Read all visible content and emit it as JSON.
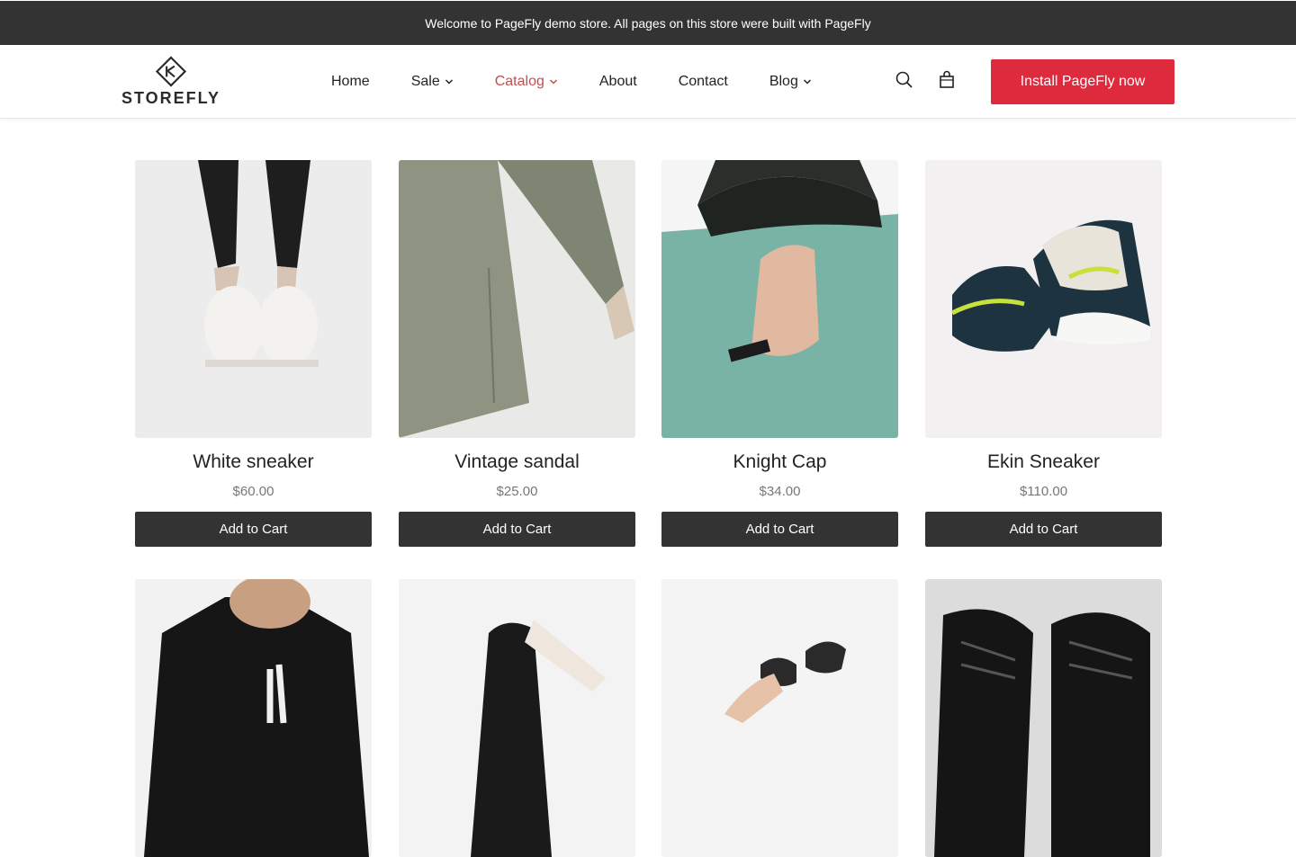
{
  "announcement": "Welcome to PageFly demo store. All pages on this store were built with PageFly",
  "logo": {
    "text": "STOREFLY"
  },
  "nav": [
    {
      "label": "Home",
      "dropdown": false,
      "active": false
    },
    {
      "label": "Sale",
      "dropdown": true,
      "active": false
    },
    {
      "label": "Catalog",
      "dropdown": true,
      "active": true
    },
    {
      "label": "About",
      "dropdown": false,
      "active": false
    },
    {
      "label": "Contact",
      "dropdown": false,
      "active": false
    },
    {
      "label": "Blog",
      "dropdown": true,
      "active": false
    }
  ],
  "header_icons": [
    "search-icon",
    "cart-icon"
  ],
  "install_button": "Install PageFly now",
  "colors": {
    "announcement_bg": "#333333",
    "accent": "#dd2a3c",
    "active_nav": "#c0504d",
    "button_dark": "#333333"
  },
  "products": [
    {
      "name": "White sneaker",
      "price": "$60.00",
      "cta": "Add to Cart"
    },
    {
      "name": "Vintage sandal",
      "price": "$25.00",
      "cta": "Add to Cart"
    },
    {
      "name": "Knight Cap",
      "price": "$34.00",
      "cta": "Add to Cart"
    },
    {
      "name": "Ekin Sneaker",
      "price": "$110.00",
      "cta": "Add to Cart"
    }
  ]
}
